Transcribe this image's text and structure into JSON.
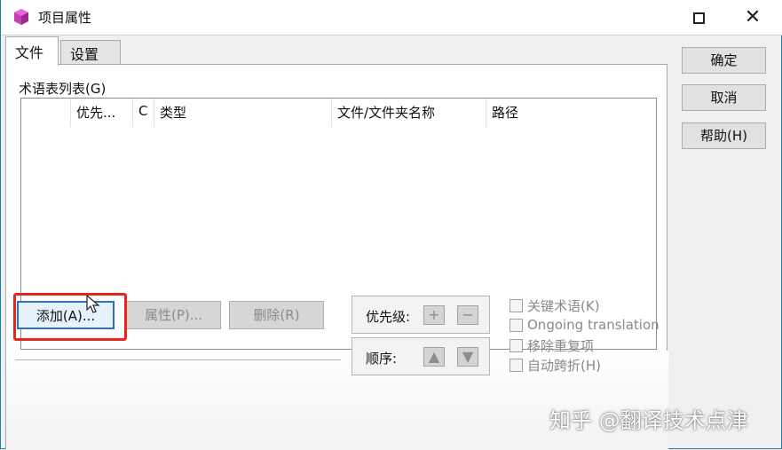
{
  "window": {
    "title": "项目属性",
    "close_glyph": "✕"
  },
  "tabs": [
    {
      "label": "文件",
      "active": true
    },
    {
      "label": "设置",
      "active": false
    }
  ],
  "glossary": {
    "group_label": "术语表列表(G)",
    "columns": [
      "",
      "优先...",
      "C",
      "类型",
      "文件/文件夹名称",
      "路径"
    ],
    "rows": []
  },
  "buttons": {
    "add": "添加(A)...",
    "properties": "属性(P)...",
    "delete": "删除(R)"
  },
  "priority": {
    "label": "优先级:",
    "up": "+",
    "down": "−"
  },
  "order": {
    "label": "顺序:",
    "up": "▲",
    "down": "▼"
  },
  "options": [
    {
      "label": "关键术语(K)",
      "checked": false
    },
    {
      "label": "Ongoing translation",
      "checked": false
    },
    {
      "label": "移除重复项",
      "checked": false
    },
    {
      "label": "自动跨折(H)",
      "checked": false
    }
  ],
  "side_buttons": {
    "ok": "确定",
    "cancel": "取消",
    "help": "帮助(H)"
  },
  "watermark": "知乎 @翻译技术点津",
  "colors": {
    "title_border": "#1b7fa8",
    "highlight": "#e8241c",
    "focus_border": "#2a6fc9"
  }
}
